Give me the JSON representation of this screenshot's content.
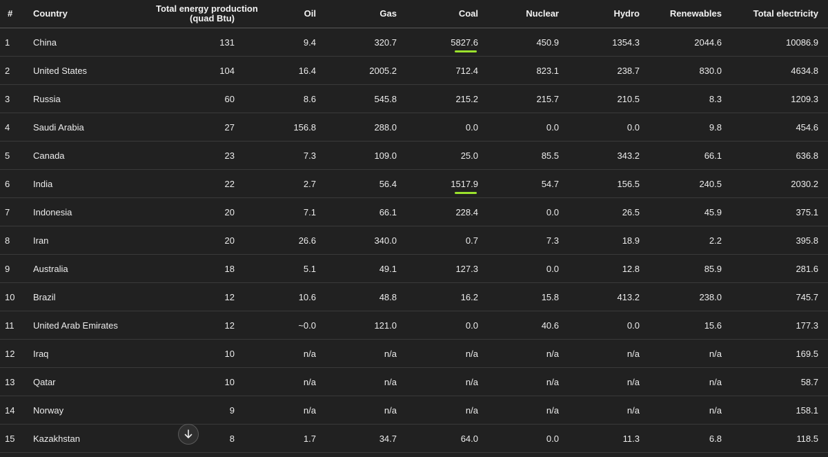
{
  "table": {
    "headers": {
      "rank": "#",
      "country": "Country",
      "total_line1": "Total energy production",
      "total_line2": "(quad Btu)",
      "oil": "Oil",
      "gas": "Gas",
      "coal": "Coal",
      "nuclear": "Nuclear",
      "hydro": "Hydro",
      "renewables": "Renewables",
      "total_electricity": "Total electricity"
    },
    "rows": [
      {
        "rank": "1",
        "country": "China",
        "total": "131",
        "oil": "9.4",
        "gas": "320.7",
        "coal": "5827.6",
        "nuclear": "450.9",
        "hydro": "1354.3",
        "renewables": "2044.6",
        "electricity": "10086.9"
      },
      {
        "rank": "2",
        "country": "United States",
        "total": "104",
        "oil": "16.4",
        "gas": "2005.2",
        "coal": "712.4",
        "nuclear": "823.1",
        "hydro": "238.7",
        "renewables": "830.0",
        "electricity": "4634.8"
      },
      {
        "rank": "3",
        "country": "Russia",
        "total": "60",
        "oil": "8.6",
        "gas": "545.8",
        "coal": "215.2",
        "nuclear": "215.7",
        "hydro": "210.5",
        "renewables": "8.3",
        "electricity": "1209.3"
      },
      {
        "rank": "4",
        "country": "Saudi Arabia",
        "total": "27",
        "oil": "156.8",
        "gas": "288.0",
        "coal": "0.0",
        "nuclear": "0.0",
        "hydro": "0.0",
        "renewables": "9.8",
        "electricity": "454.6"
      },
      {
        "rank": "5",
        "country": "Canada",
        "total": "23",
        "oil": "7.3",
        "gas": "109.0",
        "coal": "25.0",
        "nuclear": "85.5",
        "hydro": "343.2",
        "renewables": "66.1",
        "electricity": "636.8"
      },
      {
        "rank": "6",
        "country": "India",
        "total": "22",
        "oil": "2.7",
        "gas": "56.4",
        "coal": "1517.9",
        "nuclear": "54.7",
        "hydro": "156.5",
        "renewables": "240.5",
        "electricity": "2030.2"
      },
      {
        "rank": "7",
        "country": "Indonesia",
        "total": "20",
        "oil": "7.1",
        "gas": "66.1",
        "coal": "228.4",
        "nuclear": "0.0",
        "hydro": "26.5",
        "renewables": "45.9",
        "electricity": "375.1"
      },
      {
        "rank": "8",
        "country": "Iran",
        "total": "20",
        "oil": "26.6",
        "gas": "340.0",
        "coal": "0.7",
        "nuclear": "7.3",
        "hydro": "18.9",
        "renewables": "2.2",
        "electricity": "395.8"
      },
      {
        "rank": "9",
        "country": "Australia",
        "total": "18",
        "oil": "5.1",
        "gas": "49.1",
        "coal": "127.3",
        "nuclear": "0.0",
        "hydro": "12.8",
        "renewables": "85.9",
        "electricity": "281.6"
      },
      {
        "rank": "10",
        "country": "Brazil",
        "total": "12",
        "oil": "10.6",
        "gas": "48.8",
        "coal": "16.2",
        "nuclear": "15.8",
        "hydro": "413.2",
        "renewables": "238.0",
        "electricity": "745.7"
      },
      {
        "rank": "11",
        "country": "United Arab Emirates",
        "total": "12",
        "oil": "~0.0",
        "gas": "121.0",
        "coal": "0.0",
        "nuclear": "40.6",
        "hydro": "0.0",
        "renewables": "15.6",
        "electricity": "177.3"
      },
      {
        "rank": "12",
        "country": "Iraq",
        "total": "10",
        "oil": "n/a",
        "gas": "n/a",
        "coal": "n/a",
        "nuclear": "n/a",
        "hydro": "n/a",
        "renewables": "n/a",
        "electricity": "169.5"
      },
      {
        "rank": "13",
        "country": "Qatar",
        "total": "10",
        "oil": "n/a",
        "gas": "n/a",
        "coal": "n/a",
        "nuclear": "n/a",
        "hydro": "n/a",
        "renewables": "n/a",
        "electricity": "58.7"
      },
      {
        "rank": "14",
        "country": "Norway",
        "total": "9",
        "oil": "n/a",
        "gas": "n/a",
        "coal": "n/a",
        "nuclear": "n/a",
        "hydro": "n/a",
        "renewables": "n/a",
        "electricity": "158.1"
      },
      {
        "rank": "15",
        "country": "Kazakhstan",
        "total": "8",
        "oil": "1.7",
        "gas": "34.7",
        "coal": "64.0",
        "nuclear": "0.0",
        "hydro": "11.3",
        "renewables": "6.8",
        "electricity": "118.5"
      }
    ],
    "highlighted_coal_rows": [
      0,
      5
    ],
    "highlight_color": "#9be22d"
  },
  "scroll_button": {
    "icon": "arrow-down-icon"
  },
  "colors": {
    "background": "#212121",
    "text": "#ececec",
    "header_border": "#5a5a5a",
    "row_border": "#3a3a3a"
  }
}
